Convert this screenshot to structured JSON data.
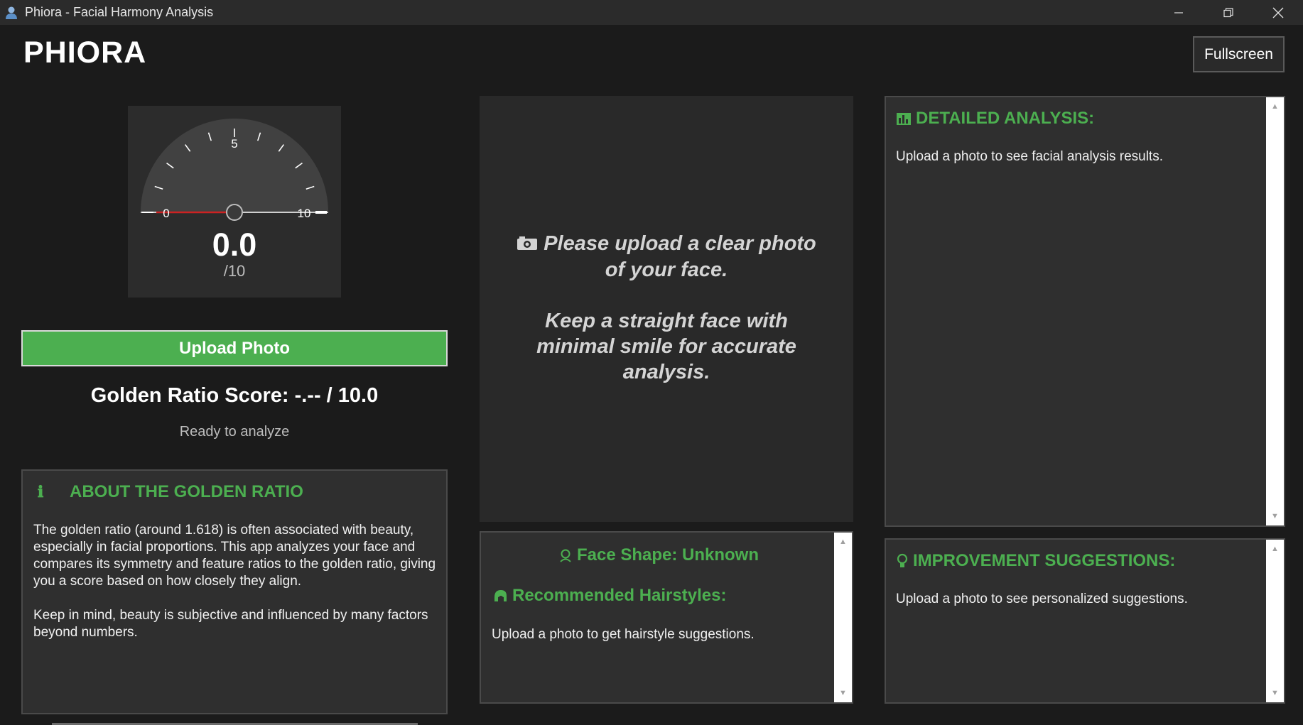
{
  "window": {
    "title": "Phiora - Facial Harmony Analysis",
    "icon": "user-icon",
    "controls": [
      "minimize",
      "restore",
      "close"
    ]
  },
  "header": {
    "brand": "PHIORA",
    "fullscreen_label": "Fullscreen"
  },
  "gauge": {
    "min_label": "0",
    "mid_label": "5",
    "max_label": "10",
    "value": "0.0",
    "denominator": "/10",
    "level": 0
  },
  "upload": {
    "button_label": "Upload Photo",
    "score_label": "Golden Ratio Score: -.-- / 10.0",
    "status": "Ready to analyze"
  },
  "about": {
    "icon": "info-icon",
    "heading": "ABOUT THE GOLDEN RATIO",
    "paragraph1": "The golden ratio (around 1.618) is often associated with beauty, especially in facial proportions. This app analyzes your face and compares its symmetry and feature ratios to the golden ratio, giving you a score based on how closely they align.",
    "paragraph2": "Keep in mind, beauty is subjective and influenced by many factors beyond numbers."
  },
  "preview": {
    "icon": "camera-icon",
    "line1": "Please upload a clear photo",
    "line2": "of your face.",
    "line3": "Keep a straight face with",
    "line4": "minimal smile for accurate",
    "line5": "analysis."
  },
  "face": {
    "shape_label": "Face Shape: Unknown",
    "hairstyles_heading": "Recommended Hairstyles:",
    "body": "Upload a photo to get hairstyle suggestions."
  },
  "detailed": {
    "heading": "DETAILED ANALYSIS:",
    "body": "Upload a photo to see facial analysis results."
  },
  "improvement": {
    "heading": "IMPROVEMENT SUGGESTIONS:",
    "body": "Upload a photo to see personalized suggestions."
  },
  "colors": {
    "accent": "#4caf50",
    "background": "#1b1b1b",
    "panel": "#2f2f2f",
    "needle": "#cc2222"
  }
}
